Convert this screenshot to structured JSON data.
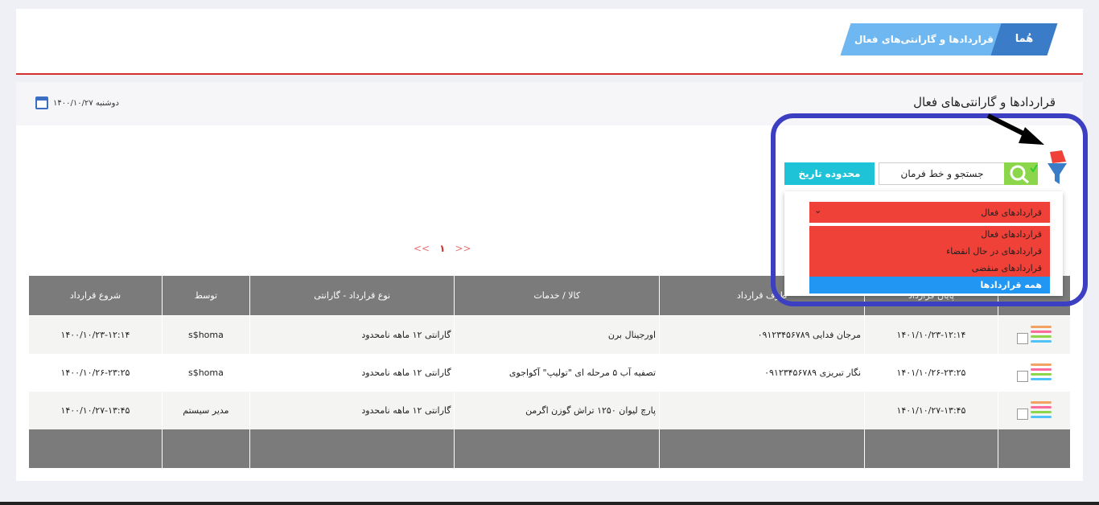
{
  "breadcrumb": {
    "home": "هُما",
    "page": "قراردادها و گارانتی‌های فعال"
  },
  "page_title": "قراردادها و گارانتی‌های فعال",
  "date": "دوشنبه ۱۴۰۰/۱۰/۲۷",
  "search": {
    "label": "جستجو و خط فرمان"
  },
  "date_range_label": "محدوده تاریخ",
  "dropdown": {
    "selected": "قراردادهای فعال",
    "options": [
      "قراردادهای فعال",
      "قراردادهای در حال انقضاء",
      "قراردادهای منقضی",
      "همه قراردادها"
    ]
  },
  "pager": {
    "prev": "<<",
    "current": "۱",
    "next": ">>"
  },
  "table": {
    "headers": [
      "",
      "پایان قرارداد",
      "طرف قرارداد",
      "کالا / خدمات",
      "نوع قرارداد - گارانتی",
      "توسط",
      "شروع قرارداد"
    ],
    "rows": [
      {
        "end": "۱۴۰۱/۱۰/۲۳-۱۲:۱۴",
        "party": "مرجان فدایی ۰۹۱۲۳۴۵۶۷۸۹",
        "product": "اورجینال برن",
        "type": "گارانتی ۱۲ ماهه نامحدود",
        "by": "s$homa",
        "start": "۱۴۰۰/۱۰/۲۳-۱۲:۱۴"
      },
      {
        "end": "۱۴۰۱/۱۰/۲۶-۲۳:۲۵",
        "party": "نگار تبریزی ۰۹۱۲۳۴۵۶۷۸۹",
        "product": "تصفیه آب ۵ مرحله ای \"تولیپ\" آکواجوی",
        "type": "گارانتی ۱۲ ماهه نامحدود",
        "by": "s$homa",
        "start": "۱۴۰۰/۱۰/۲۶-۲۳:۲۵"
      },
      {
        "end": "۱۴۰۱/۱۰/۲۷-۱۳:۴۵",
        "party": "",
        "product": "پارچ لیوان ۱۲۵۰ تراش گوزن اگرمن",
        "type": "گارانتی ۱۲ ماهه نامحدود",
        "by": "مدیر سیستم",
        "start": "۱۴۰۰/۱۰/۲۷-۱۳:۴۵"
      }
    ]
  },
  "colors": {
    "accent_red": "#ef4138",
    "selected_blue": "#2196f3",
    "header_gray": "#7b7b7b",
    "highlight_ring": "#3c3fc2"
  }
}
